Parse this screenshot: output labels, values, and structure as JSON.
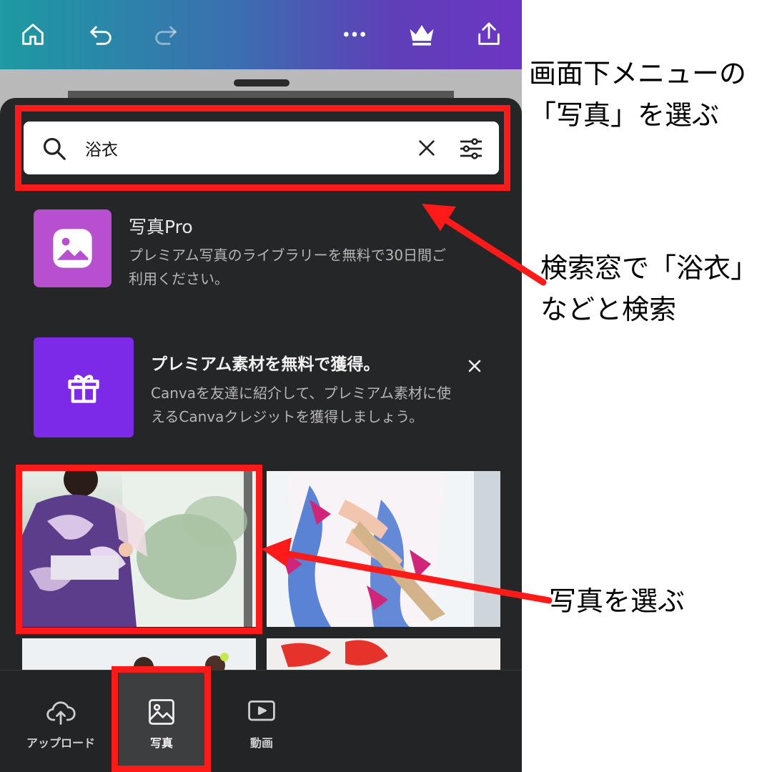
{
  "search": {
    "value": "浴衣"
  },
  "photos_pro": {
    "title": "写真Pro",
    "description_line1": "プレミアム写真のライブラリーを無料で30日間ご",
    "description_line2": "利用ください。"
  },
  "promo": {
    "title": "プレミアム素材を無料で獲得。",
    "line1": "Canvaを友達に紹介して、プレミアム素材に使",
    "line2": "えるCanvaクレジットを獲得しましょう。"
  },
  "tabs": [
    {
      "label": "アップロード",
      "icon": "cloud-upload-icon"
    },
    {
      "label": "写真",
      "icon": "image-icon",
      "selected": true
    },
    {
      "label": "動画",
      "icon": "video-icon"
    }
  ],
  "annotations": {
    "a1_line1": "画面下メニューの",
    "a1_line2": "「写真」を選ぶ",
    "a2_line1": "検索窓で「浴衣」",
    "a2_line2": "などと検索",
    "a3": "写真を選ぶ"
  },
  "colors": {
    "highlight": "#ff1a1a",
    "pro_icon": "#b84fd0",
    "promo_icon": "#7c2ae8",
    "sheet": "#252627"
  }
}
